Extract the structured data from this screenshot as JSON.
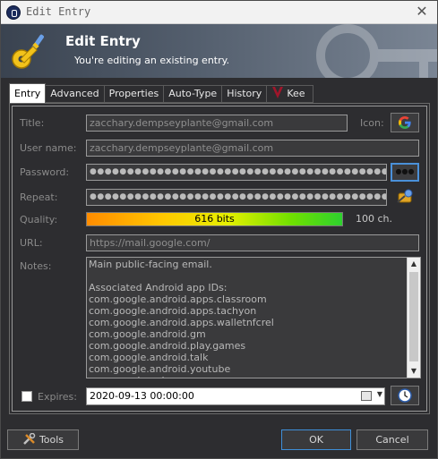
{
  "window": {
    "title": "Edit Entry",
    "close_glyph": "✕"
  },
  "banner": {
    "heading": "Edit Entry",
    "subtitle": "You're editing an existing entry."
  },
  "tabs": [
    {
      "label": "Entry",
      "active": true
    },
    {
      "label": "Advanced"
    },
    {
      "label": "Properties"
    },
    {
      "label": "Auto-Type"
    },
    {
      "label": "History"
    },
    {
      "label": "Kee"
    }
  ],
  "entry": {
    "title_label": "Title:",
    "title_value": "zacchary.dempseyplante@gmail.com",
    "icon_label": "Icon:",
    "username_label": "User name:",
    "username_value": "zacchary.dempseyplante@gmail.com",
    "password_label": "Password:",
    "password_value": "●●●●●●●●●●●●●●●●●●●●●●●●●●●●●●●●●●●●●●●●●●●●●●●●●●●",
    "show_password_glyph": "●●●",
    "repeat_label": "Repeat:",
    "repeat_value": "●●●●●●●●●●●●●●●●●●●●●●●●●●●●●●●●●●●●●●●●●●●●●●●●●●●●●●●●",
    "quality_label": "Quality:",
    "quality_text": "616 bits",
    "quality_chars": "100 ch.",
    "url_label": "URL:",
    "url_value": "https://mail.google.com/",
    "notes_label": "Notes:",
    "notes_value": "Main public-facing email.\n\nAssociated Android app IDs:\ncom.google.android.apps.classroom\ncom.google.android.apps.tachyon\ncom.google.android.apps.walletnfcrel\ncom.google.android.gm\ncom.google.android.play.games\ncom.google.android.talk\ncom.google.android.youtube\ncom.google.ar.lens",
    "expires_label": "Expires:",
    "expires_value": "2020-09-13 00:00:00"
  },
  "footer": {
    "tools_label": "Tools",
    "ok_label": "OK",
    "cancel_label": "Cancel"
  },
  "icons": {
    "app": "keepass-lock-icon",
    "banner": "key-icon",
    "entry_icon": "google-icon",
    "generator": "password-generator-icon",
    "expiry": "clock-icon",
    "tools": "tools-icon",
    "kee": "kee-icon"
  },
  "colors": {
    "accent": "#3f8fd8",
    "background": "#2d2d30",
    "quality_low": "#ff8c00",
    "quality_high": "#2ed12e"
  }
}
